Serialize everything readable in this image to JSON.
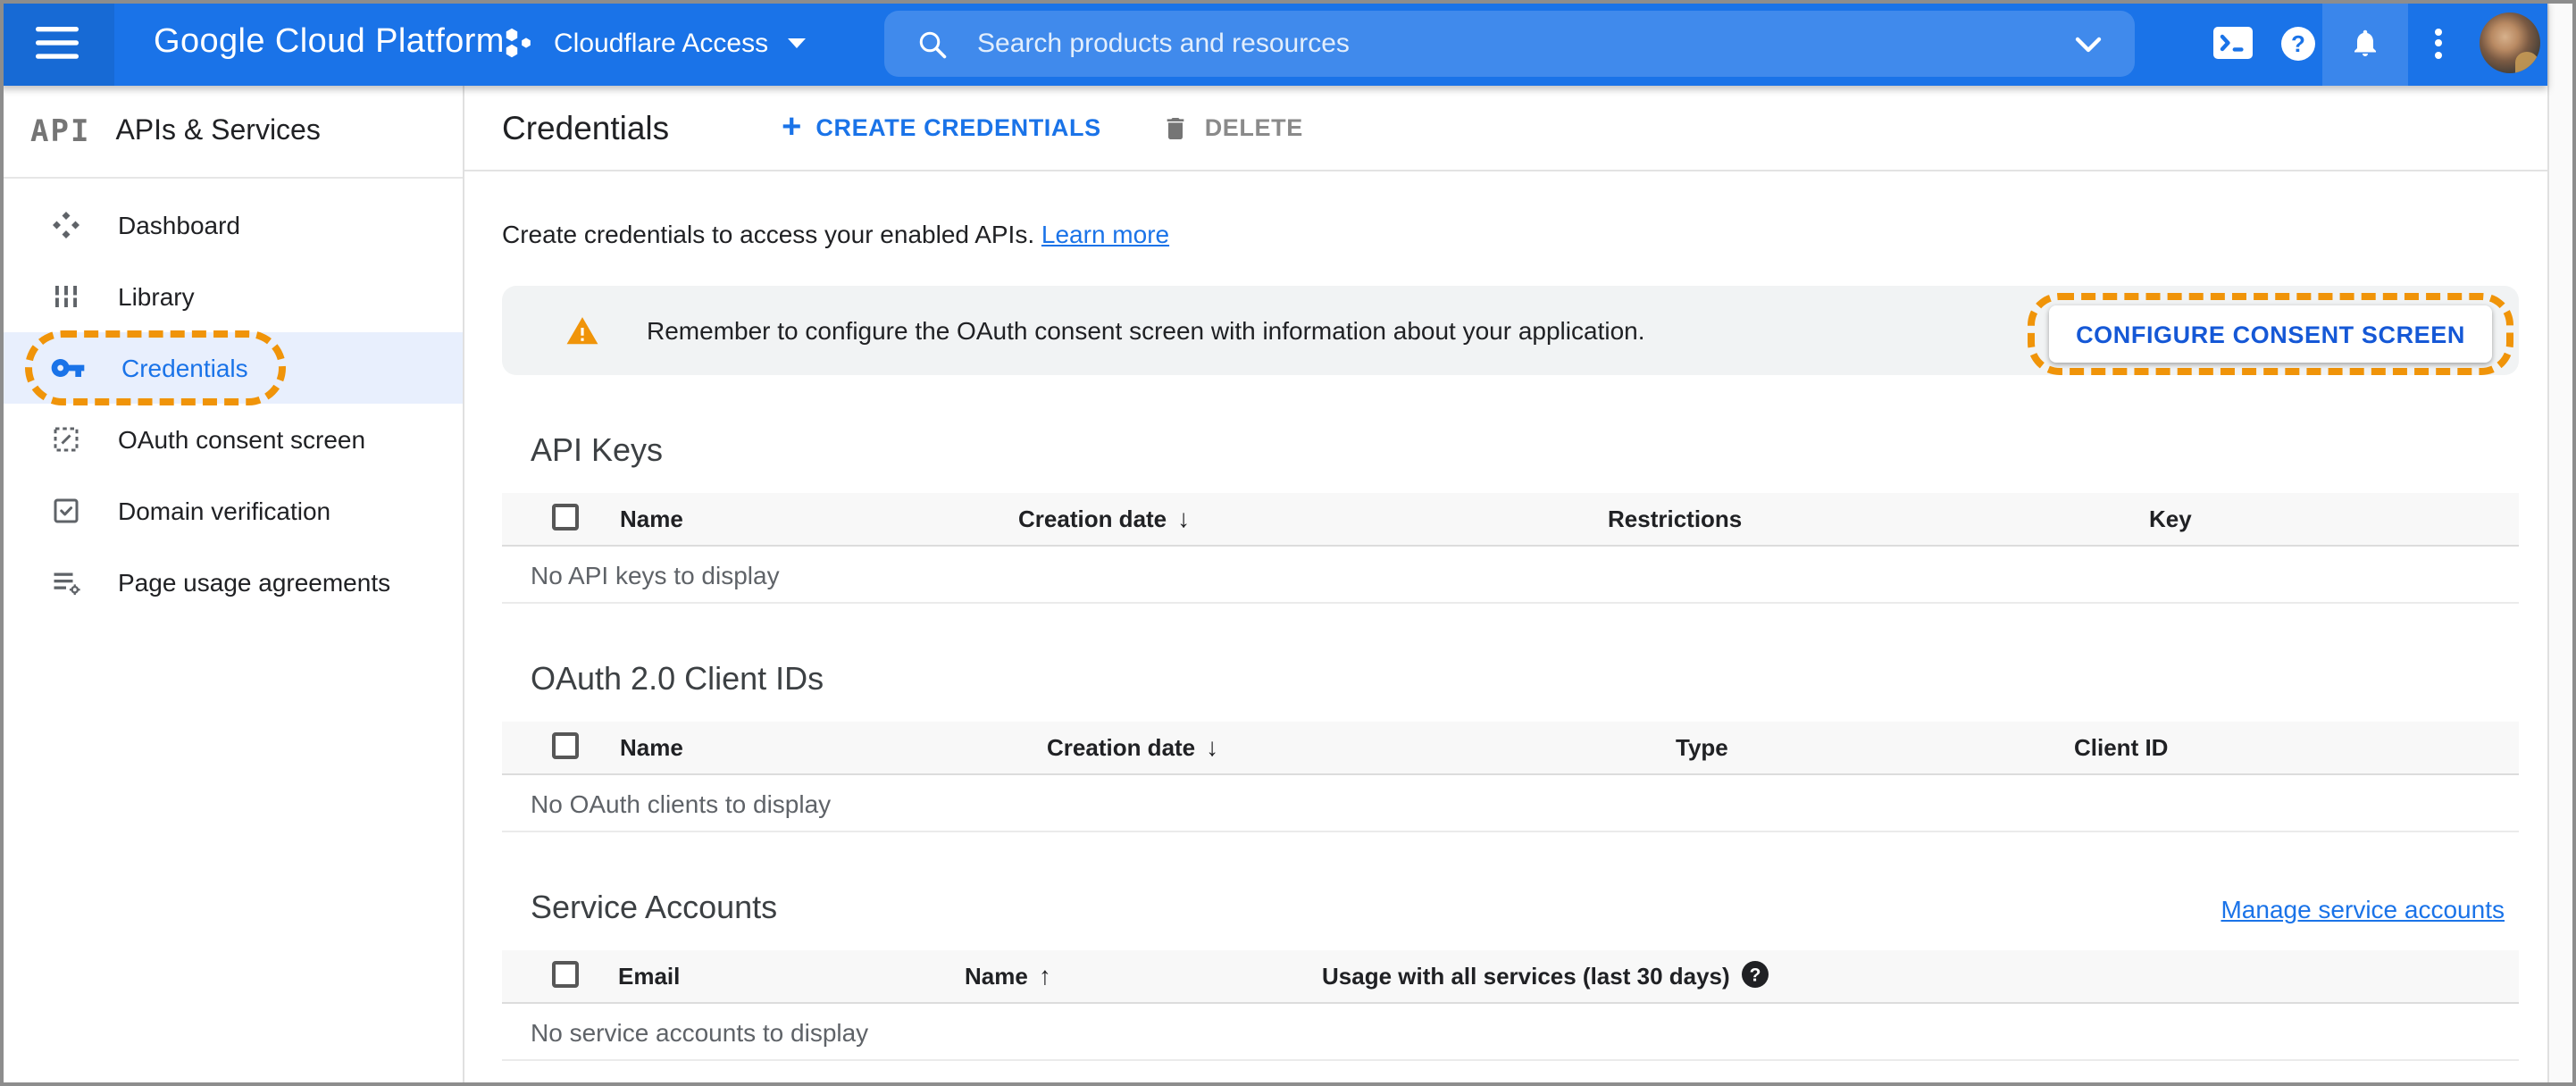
{
  "header": {
    "product_name": "Google Cloud Platform",
    "project_selector": {
      "label": "Cloudflare Access"
    },
    "search": {
      "placeholder": "Search products and resources"
    }
  },
  "sidebar": {
    "logo_text": "API",
    "title": "APIs & Services",
    "items": [
      {
        "label": "Dashboard"
      },
      {
        "label": "Library"
      },
      {
        "label": "Credentials",
        "active": true,
        "tutorial_highlight": true
      },
      {
        "label": "OAuth consent screen"
      },
      {
        "label": "Domain verification"
      },
      {
        "label": "Page usage agreements"
      }
    ]
  },
  "page": {
    "title": "Credentials",
    "actions": {
      "create": "CREATE CREDENTIALS",
      "delete": "DELETE"
    },
    "intro": {
      "text": "Create credentials to access your enabled APIs.",
      "link": "Learn more"
    },
    "banner": {
      "text": "Remember to configure the OAuth consent screen with information about your application.",
      "button": "CONFIGURE CONSENT SCREEN",
      "tutorial_highlight": true
    },
    "sections": [
      {
        "title": "API Keys",
        "columns": [
          "Name",
          "Creation date",
          "Restrictions",
          "Key"
        ],
        "sort_column": "Creation date",
        "sort_direction": "descending",
        "empty": "No API keys to display"
      },
      {
        "title": "OAuth 2.0 Client IDs",
        "columns": [
          "Name",
          "Creation date",
          "Type",
          "Client ID"
        ],
        "sort_column": "Creation date",
        "sort_direction": "descending",
        "empty": "No OAuth clients to display"
      },
      {
        "title": "Service Accounts",
        "manage_link": "Manage service accounts",
        "columns": [
          "Email",
          "Name",
          "Usage with all services (last 30 days)"
        ],
        "sort_column": "Name",
        "sort_direction": "ascending",
        "empty": "No service accounts to display"
      }
    ]
  },
  "icons": {
    "sort_desc_glyph": "↓",
    "sort_asc_glyph": "↑",
    "help_glyph": "?",
    "plus_glyph": "+"
  },
  "colors": {
    "header_blue": "#1a73e8",
    "link_blue": "#1a73e8",
    "tutorial_orange": "#f09409",
    "active_item_bg": "#e8effd",
    "banner_bg": "#f1f3f4",
    "table_header_bg": "#f8f8f8"
  }
}
